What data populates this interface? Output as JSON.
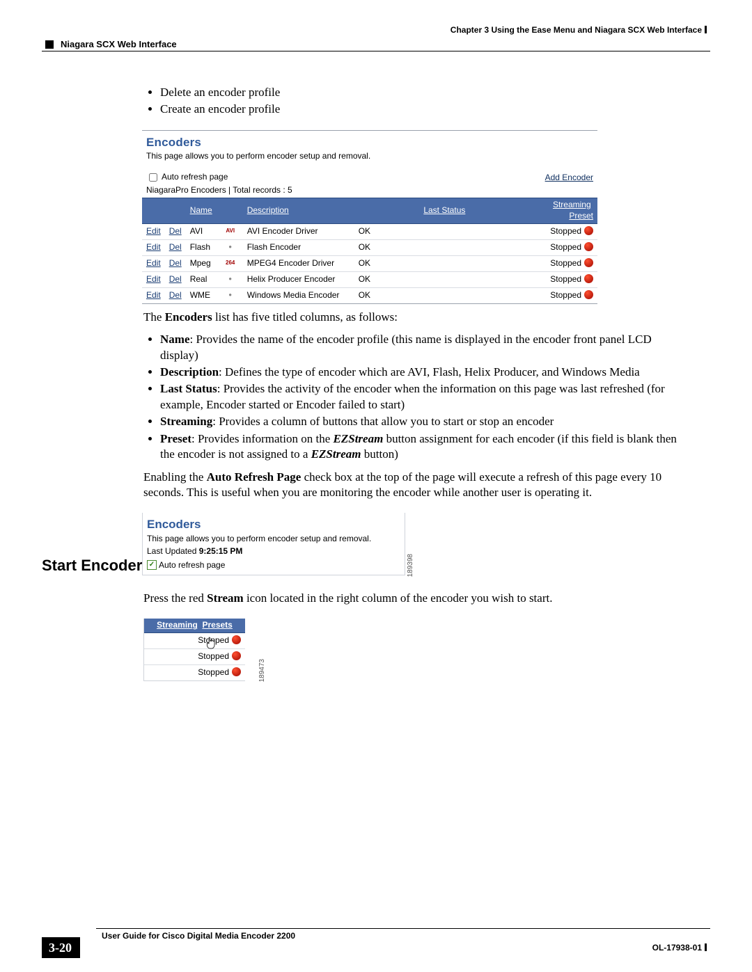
{
  "header": {
    "chapter": "Chapter 3    Using the Ease Menu and Niagara SCX Web Interface",
    "section": "Niagara SCX Web Interface"
  },
  "intro_bullets": [
    "Delete an encoder profile",
    "Create an encoder profile"
  ],
  "shot1": {
    "title": "Encoders",
    "sub": "This page allows you to perform encoder setup and removal.",
    "auto_refresh_label": "Auto refresh page",
    "add_encoder": "Add Encoder",
    "count_line": "NiagaraPro Encoders | Total records : 5",
    "headers": {
      "name": "Name",
      "desc": "Description",
      "last": "Last Status",
      "stream": "Streaming",
      "preset": "Preset"
    },
    "act": {
      "edit": "Edit",
      "del": "Del"
    },
    "rows": [
      {
        "name": "AVI",
        "badge": "AVI",
        "desc": "AVI Encoder Driver",
        "status": "OK",
        "stream": "Stopped"
      },
      {
        "name": "Flash",
        "badge": "",
        "desc": "Flash Encoder",
        "status": "OK",
        "stream": "Stopped"
      },
      {
        "name": "Mpeg",
        "badge": "264",
        "desc": "MPEG4 Encoder Driver",
        "status": "OK",
        "stream": "Stopped"
      },
      {
        "name": "Real",
        "badge": "",
        "desc": "Helix Producer Encoder",
        "status": "OK",
        "stream": "Stopped"
      },
      {
        "name": "WME",
        "badge": "",
        "desc": "Windows Media Encoder",
        "status": "OK",
        "stream": "Stopped"
      }
    ]
  },
  "after_shot1_intro": {
    "pre": "The ",
    "bold": "Encoders",
    "post": " list has five titled columns, as follows:"
  },
  "column_items": [
    {
      "term": "Name",
      "rest": ": Provides the name of the encoder profile (this name is displayed in the encoder front panel LCD display)"
    },
    {
      "term": "Description",
      "rest": ": Defines the type of encoder which are AVI, Flash, Helix Producer, and Windows Media"
    },
    {
      "term": "Last Status",
      "rest": ": Provides the activity of the encoder when the information on this page was last refreshed (for example, Encoder started or Encoder failed to start)"
    },
    {
      "term": "Streaming",
      "rest": ": Provides a column of buttons that allow you to start or stop an encoder"
    }
  ],
  "preset_item": {
    "term": "Preset",
    "p1a": ": Provides information on the ",
    "p1b": "EZStream",
    "p1c": " button assignment for each encoder (if this field is blank then the encoder is not assigned to a ",
    "p1d": "EZStream",
    "p1e": " button)"
  },
  "auto_refresh_para": {
    "a": "Enabling the ",
    "b": "Auto Refresh Page",
    "c": " check box at the top of the page will execute a refresh of this page every 10 seconds. This is useful when you are monitoring the encoder while another user is operating it."
  },
  "shot2": {
    "title": "Encoders",
    "sub": "This page allows you to perform encoder setup and removal.",
    "lastup_pre": "Last Updated ",
    "lastup_time": "9:25:15 PM",
    "auto_refresh_label": "Auto refresh page",
    "side_id": "189398"
  },
  "h2": "Start Encoder",
  "start_para": {
    "a": "Press the red ",
    "b": "Stream",
    "c": " icon located in the right column of the encoder you wish to start."
  },
  "shot3": {
    "headers": {
      "stream": "Streaming",
      "presets": "Presets"
    },
    "rows": [
      {
        "label": "Stopped"
      },
      {
        "label": "Stopped"
      },
      {
        "label": "Stopped"
      }
    ],
    "side_id": "189473"
  },
  "footer": {
    "book": "User Guide for Cisco Digital Media Encoder 2200",
    "page_num": "3-20",
    "ol": "OL-17938-01"
  }
}
